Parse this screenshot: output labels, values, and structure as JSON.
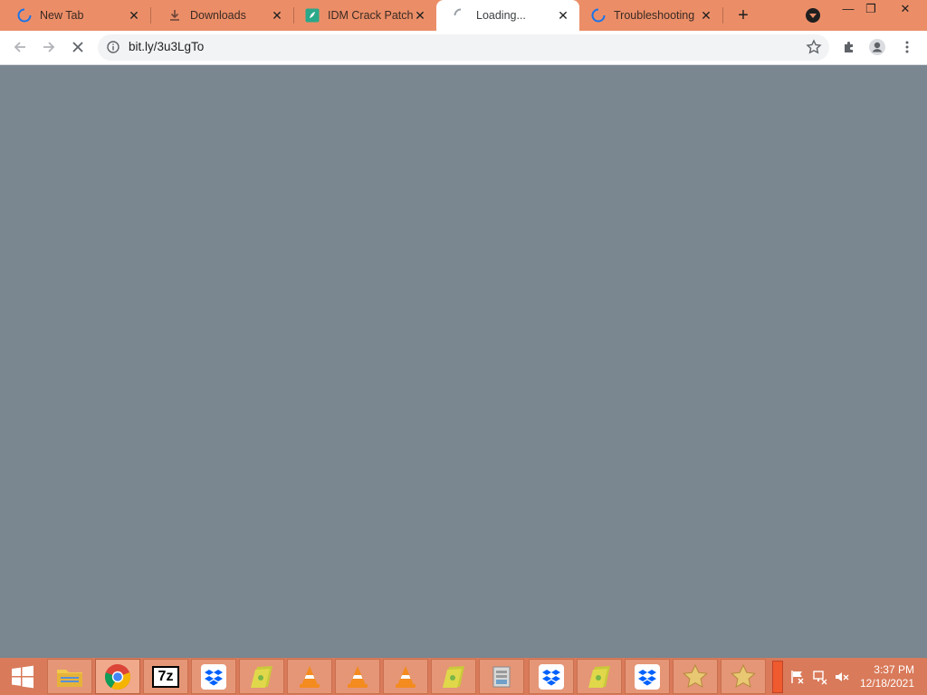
{
  "browser": {
    "tabs": [
      {
        "title": "New Tab",
        "icon": "loading-spinner-icon",
        "close": "✕"
      },
      {
        "title": "Downloads",
        "icon": "download-icon",
        "close": "✕"
      },
      {
        "title": "IDM Crack Patch",
        "icon": "site-favicon-icon",
        "close": "✕"
      },
      {
        "title": "Loading...",
        "icon": "loading-spinner-icon",
        "close": "✕"
      },
      {
        "title": "Troubleshooting",
        "icon": "loading-spinner-icon",
        "close": "✕"
      }
    ],
    "new_tab": "+",
    "window_controls": {
      "minimize": "—",
      "restore": "❐",
      "close": "✕"
    },
    "url": "bit.ly/3u3LgTo"
  },
  "taskbar": {
    "items": [
      {
        "name": "file-explorer",
        "icon": "folder-icon"
      },
      {
        "name": "google-chrome",
        "icon": "chrome-icon"
      },
      {
        "name": "7-zip",
        "icon": "7zip-icon",
        "label": "7z"
      },
      {
        "name": "dropbox-1",
        "icon": "dropbox-icon"
      },
      {
        "name": "folder-1",
        "icon": "folder-icon"
      },
      {
        "name": "vlc-1",
        "icon": "vlc-icon"
      },
      {
        "name": "vlc-2",
        "icon": "vlc-icon"
      },
      {
        "name": "vlc-3",
        "icon": "vlc-icon"
      },
      {
        "name": "folder-2",
        "icon": "folder-icon"
      },
      {
        "name": "installer",
        "icon": "installer-icon"
      },
      {
        "name": "dropbox-2",
        "icon": "dropbox-icon"
      },
      {
        "name": "folder-3",
        "icon": "folder-icon"
      },
      {
        "name": "dropbox-3",
        "icon": "dropbox-icon"
      },
      {
        "name": "favorite-1",
        "icon": "star-icon"
      },
      {
        "name": "favorite-2",
        "icon": "star-icon"
      }
    ],
    "clock": {
      "time": "3:37 PM",
      "date": "12/18/2021"
    }
  },
  "colors": {
    "tabstrip": "#eb8e68",
    "taskbar": "#d97a5a",
    "content": "#7a8690",
    "accent_blue": "#1a73e8"
  }
}
